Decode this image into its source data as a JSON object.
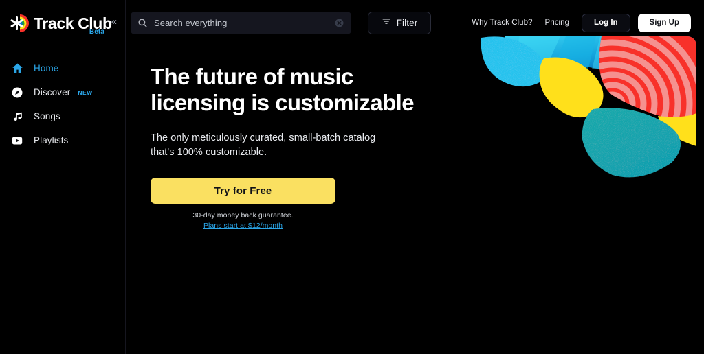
{
  "sidebar": {
    "brand": {
      "name": "Track Club",
      "logo_icon": "trackclub-asterisk-logo",
      "beta_label": "Beta",
      "collapse_icon": "double-chevron-left-icon"
    },
    "items": [
      {
        "label": "Home",
        "icon": "home-icon",
        "active": true,
        "badge": ""
      },
      {
        "label": "Discover",
        "icon": "compass-icon",
        "active": false,
        "badge": "NEW"
      },
      {
        "label": "Songs",
        "icon": "music-note-icon",
        "active": false,
        "badge": ""
      },
      {
        "label": "Playlists",
        "icon": "playlist-play-icon",
        "active": false,
        "badge": ""
      }
    ]
  },
  "topbar": {
    "search": {
      "placeholder": "Search everything",
      "value": "",
      "search_icon": "search-icon",
      "clear_icon": "clear-circle-x-icon"
    },
    "filter": {
      "label": "Filter",
      "icon": "filter-funnel-icon"
    },
    "links": [
      {
        "label": "Why Track Club?"
      },
      {
        "label": "Pricing"
      }
    ],
    "login_label": "Log In",
    "signup_label": "Sign Up"
  },
  "hero": {
    "title_line1": "The future of music",
    "title_line2": "licensing is customizable",
    "subtitle_line1": "The only meticulously curated, small-batch catalog",
    "subtitle_line2": "that's 100% customizable.",
    "cta_label": "Try for Free",
    "guarantee": "30-day money back guarantee.",
    "pricing_link": "Plans start at $12/month"
  },
  "colors": {
    "accent_blue": "#2ba6e8",
    "cta_yellow": "#fae061",
    "art_cyan": "#25c3ee",
    "art_blue": "#0b7fc4",
    "art_yellow": "#ffe01b",
    "art_red": "#f8312a",
    "art_pink": "#f5918f",
    "art_teal": "#16a5a8",
    "background": "#000000",
    "search_bg": "#15161f"
  }
}
